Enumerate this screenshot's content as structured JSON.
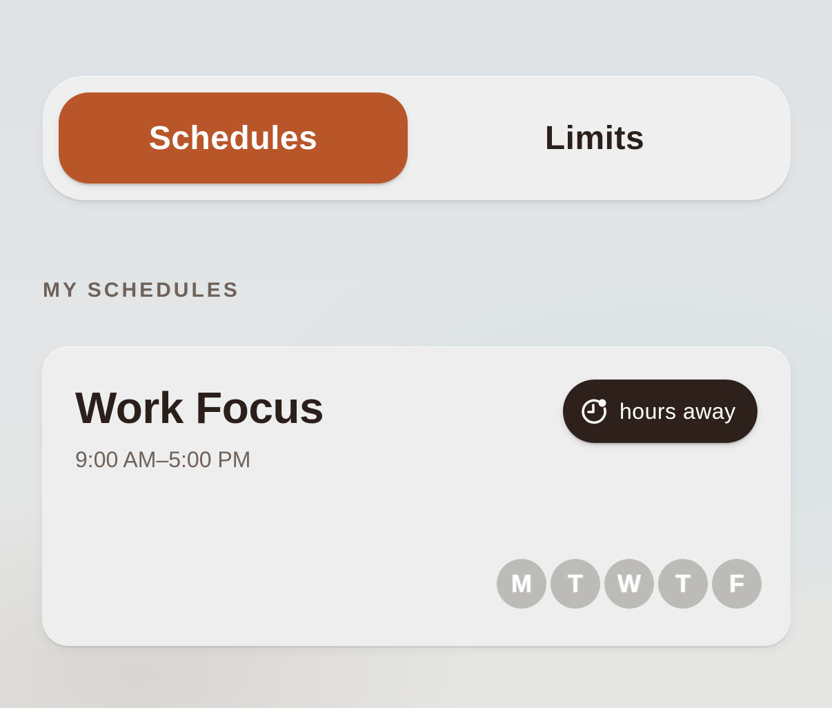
{
  "tabs": {
    "active_label": "Schedules",
    "inactive_label": "Limits"
  },
  "section": {
    "label": "MY SCHEDULES"
  },
  "schedule": {
    "title": "Work Focus",
    "time_range": "9:00 AM–5:00 PM",
    "status_badge": "hours away",
    "status_icon": "clock-alert-icon",
    "days": [
      "M",
      "T",
      "W",
      "T",
      "F"
    ]
  },
  "colors": {
    "accent": "#b8562a",
    "badge_bg": "#2e211b",
    "day_bg": "#bdbbb8",
    "text_dark": "#2a1f1a",
    "text_muted": "#6e625a"
  }
}
